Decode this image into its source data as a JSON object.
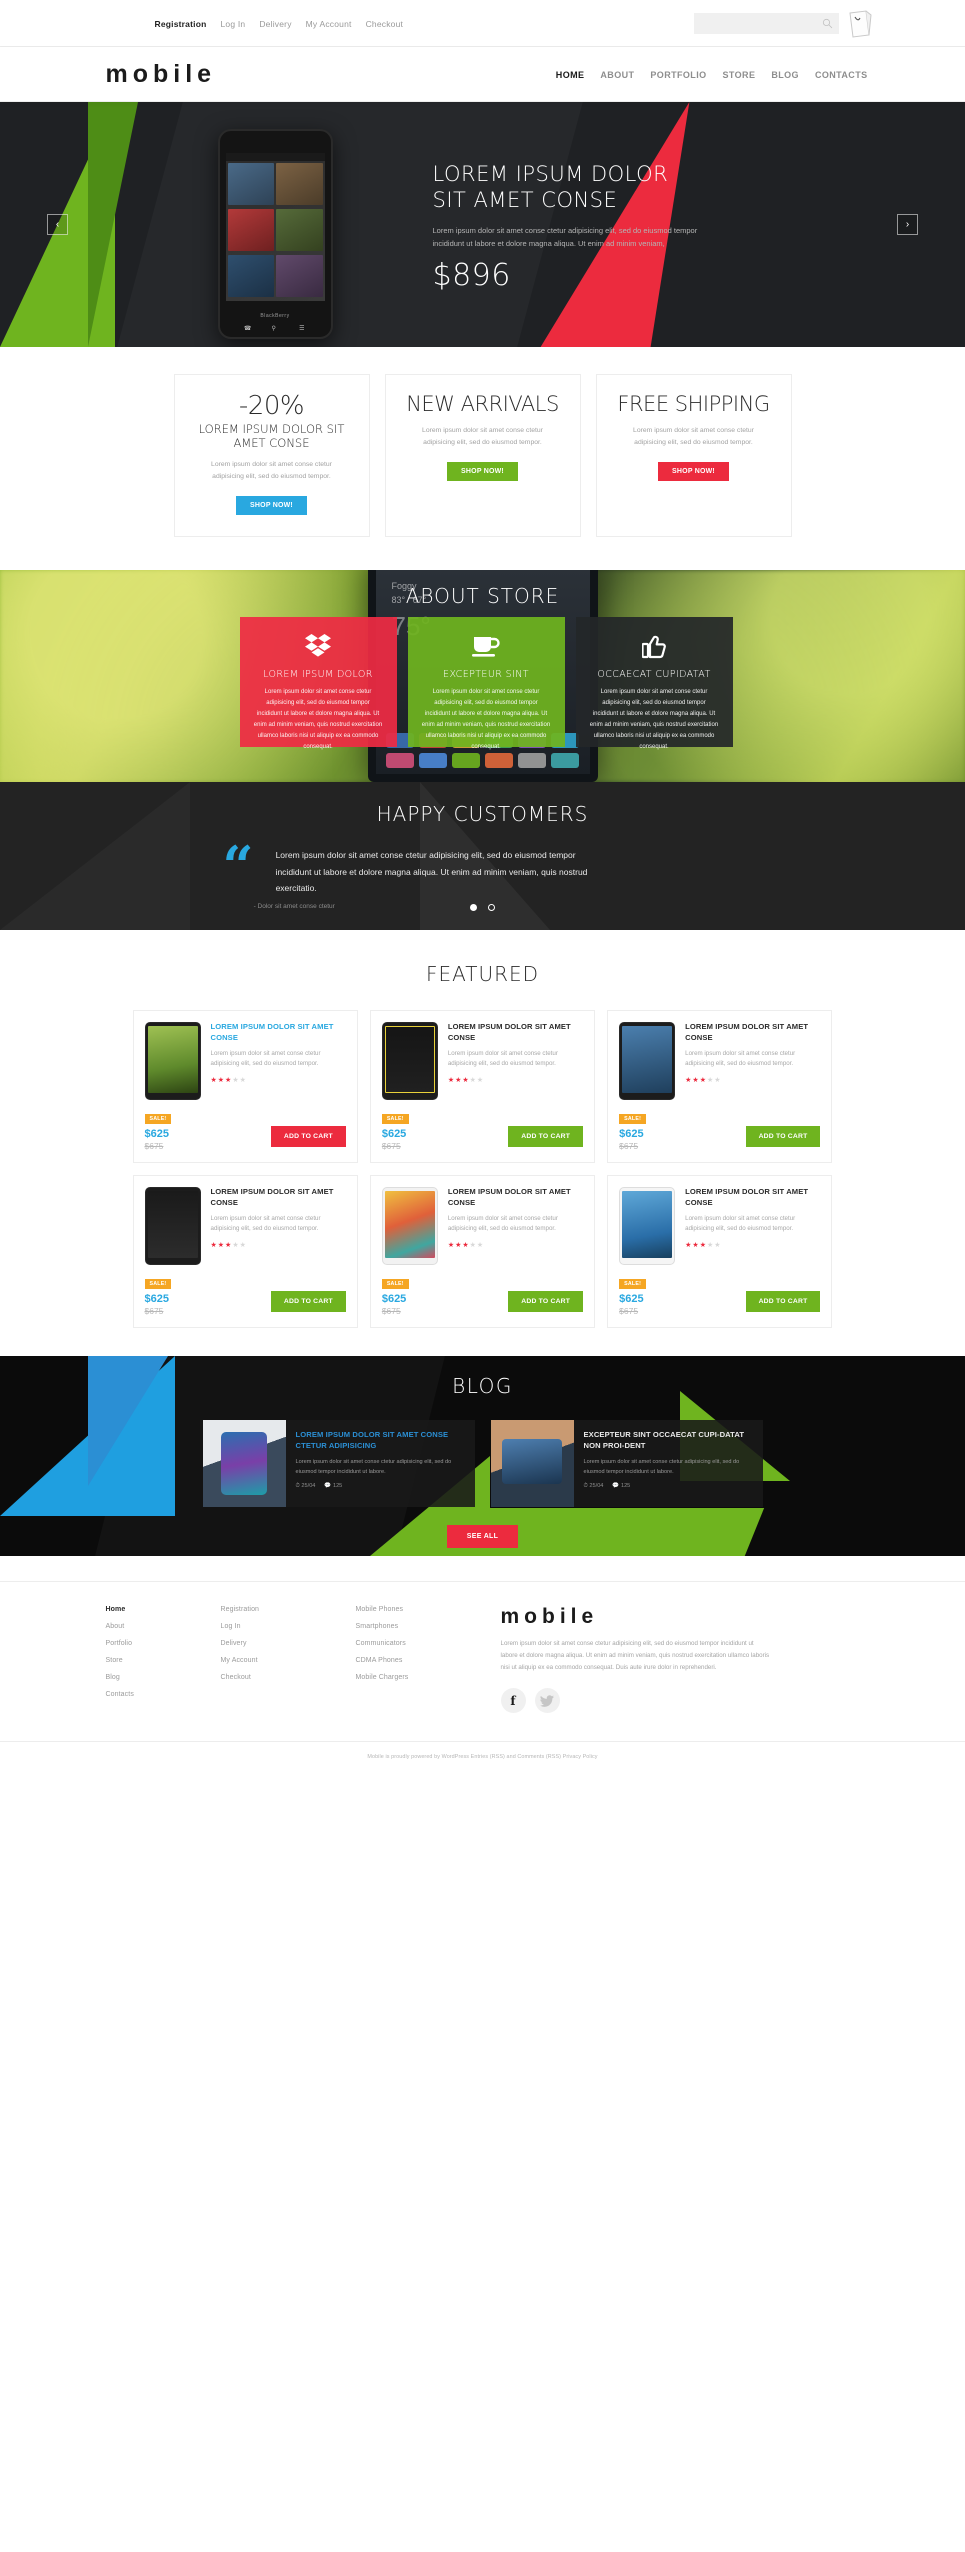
{
  "topbar": {
    "links": [
      {
        "label": "Registration",
        "active": true
      },
      {
        "label": "Log In",
        "active": false
      },
      {
        "label": "Delivery",
        "active": false
      },
      {
        "label": "My Account",
        "active": false
      },
      {
        "label": "Checkout",
        "active": false
      }
    ],
    "search": {
      "value": "",
      "placeholder": ""
    },
    "search_icon": "search-icon",
    "cart_icon": "cart-icon"
  },
  "header": {
    "logo": "mobile",
    "nav": [
      {
        "label": "HOME",
        "active": true
      },
      {
        "label": "ABOUT",
        "active": false
      },
      {
        "label": "PORTFOLIO",
        "active": false
      },
      {
        "label": "STORE",
        "active": false
      },
      {
        "label": "BLOG",
        "active": false
      },
      {
        "label": "CONTACTS",
        "active": false
      }
    ]
  },
  "hero": {
    "title_line1": "LOREM IPSUM DOLOR",
    "title_line2": "SIT AMET CONSE",
    "description": "Lorem ipsum dolor sit amet conse ctetur adipisicing elit, sed do eiusmod tempor incididunt ut labore et dolore magna aliqua. Ut enim ad minim veniam,",
    "price": "$896",
    "prev_label": "‹",
    "next_label": "›",
    "colors": {
      "blue": "#2b8fd4",
      "green": "#6fb41f",
      "red": "#ec2b3e",
      "dark": "#1f2124"
    }
  },
  "promos": [
    {
      "big": "-20%",
      "sub": "LOREM IPSUM DOLOR SIT AMET CONSE",
      "desc": "Lorem ipsum dolor sit amet conse ctetur adipisicing elit, sed do eiusmod tempor.",
      "button": "SHOP NOW!",
      "color": "#29a8e0"
    },
    {
      "big": "NEW ARRIVALS",
      "sub": "",
      "desc": "Lorem ipsum dolor sit amet conse ctetur adipisicing elit, sed do eiusmod tempor.",
      "button": "SHOP NOW!",
      "color": "#6fb41f"
    },
    {
      "big": "FREE SHIPPING",
      "sub": "",
      "desc": "Lorem ipsum dolor sit amet conse ctetur adipisicing elit, sed do eiusmod tempor.",
      "button": "SHOP NOW!",
      "color": "#ec2b3e"
    }
  ],
  "about": {
    "title": "ABOUT STORE",
    "weather": {
      "condition": "Foggy",
      "high": "83°",
      "low": "67°",
      "current": "75°"
    },
    "cards": [
      {
        "icon": "dropbox-icon",
        "title": "LOREM IPSUM DOLOR",
        "desc": "Lorem ipsum dolor sit amet conse ctetur adipisicing elit, sed do eiusmod tempor incididunt ut labore et dolore magna aliqua. Ut enim ad minim veniam, quis nostrud exercitation ullamco laboris nisi ut aliquip ex ea commodo consequat.",
        "color": "#ee2b44"
      },
      {
        "icon": "coffee-cup-icon",
        "title": "EXCEPTEUR SINT",
        "desc": "Lorem ipsum dolor sit amet conse ctetur adipisicing elit, sed do eiusmod tempor incididunt ut labore et dolore magna aliqua. Ut enim ad minim veniam, quis nostrud exercitation ullamco laboris nisi ut aliquip ex ea commodo consequat.",
        "color": "#6fb41f"
      },
      {
        "icon": "thumbs-up-icon",
        "title": "OCCAECAT CUPIDATAT",
        "desc": "Lorem ipsum dolor sit amet conse ctetur adipisicing elit, sed do eiusmod tempor incididunt ut labore et dolore magna aliqua. Ut enim ad minim veniam, quis nostrud exercitation ullamco laboris nisi ut aliquip ex ea commodo consequat.",
        "color": "#242729"
      }
    ]
  },
  "testimonial": {
    "title": "HAPPY CUSTOMERS",
    "quote": "Lorem ipsum dolor sit amet conse ctetur adipisicing elit, sed do eiusmod tempor incididunt ut labore et dolore magna aliqua. Ut enim ad minim veniam, quis nostrud exercitatio.",
    "author": "-  Dolor sit amet conse ctetur",
    "dots": [
      {
        "active": true
      },
      {
        "active": false
      }
    ]
  },
  "featured": {
    "title": "FEATURED",
    "products": [
      {
        "title": "LOREM IPSUM DOLOR SIT AMET CONSE",
        "desc": "Lorem ipsum dolor sit amet conse ctetur adipisicing elit, sed do eiusmod tempor.",
        "rating": 3,
        "rating_max": 5,
        "badge": "SALE!",
        "price": "$625",
        "old_price": "$675",
        "button": "ADD TO CART",
        "button_color": "#ec2b3e",
        "title_highlight": true
      },
      {
        "title": "LOREM IPSUM DOLOR SIT AMET CONSE",
        "desc": "Lorem ipsum dolor sit amet conse ctetur adipisicing elit, sed do eiusmod tempor.",
        "rating": 3,
        "rating_max": 5,
        "badge": "SALE!",
        "price": "$625",
        "old_price": "$675",
        "button": "ADD TO CART",
        "button_color": "#6fb41f",
        "title_highlight": false
      },
      {
        "title": "LOREM IPSUM DOLOR SIT AMET CONSE",
        "desc": "Lorem ipsum dolor sit amet conse ctetur adipisicing elit, sed do eiusmod tempor.",
        "rating": 3,
        "rating_max": 5,
        "badge": "SALE!",
        "price": "$625",
        "old_price": "$675",
        "button": "ADD TO CART",
        "button_color": "#6fb41f",
        "title_highlight": false
      },
      {
        "title": "LOREM IPSUM DOLOR SIT AMET CONSE",
        "desc": "Lorem ipsum dolor sit amet conse ctetur adipisicing elit, sed do eiusmod tempor.",
        "rating": 3,
        "rating_max": 5,
        "badge": "SALE!",
        "price": "$625",
        "old_price": "$675",
        "button": "ADD TO CART",
        "button_color": "#6fb41f",
        "title_highlight": false
      },
      {
        "title": "LOREM IPSUM DOLOR SIT AMET CONSE",
        "desc": "Lorem ipsum dolor sit amet conse ctetur adipisicing elit, sed do eiusmod tempor.",
        "rating": 3,
        "rating_max": 5,
        "badge": "SALE!",
        "price": "$625",
        "old_price": "$675",
        "button": "ADD TO CART",
        "button_color": "#6fb41f",
        "title_highlight": false
      },
      {
        "title": "LOREM IPSUM DOLOR SIT AMET CONSE",
        "desc": "Lorem ipsum dolor sit amet conse ctetur adipisicing elit, sed do eiusmod tempor.",
        "rating": 3,
        "rating_max": 5,
        "badge": "SALE!",
        "price": "$625",
        "old_price": "$675",
        "button": "ADD TO CART",
        "button_color": "#6fb41f",
        "title_highlight": false
      }
    ]
  },
  "blog": {
    "title": "BLOG",
    "posts": [
      {
        "title": "LOREM IPSUM DOLOR SIT AMET CONSE CTETUR ADIPISICING",
        "desc": "Lorem ipsum dolor sit amet conse ctetur adipisicing elit, sed do eiusmod tempor incididunt ut labore.",
        "date": "25/04",
        "comments": "125",
        "highlight": true
      },
      {
        "title": "EXCEPTEUR SINT OCCAECAT CUPI-DATAT NON PROI-DENT",
        "desc": "Lorem ipsum dolor sit amet conse ctetur adipisicing elit, sed do eiusmod tempor incididunt ut labore.",
        "date": "25/04",
        "comments": "125",
        "highlight": false
      }
    ],
    "see_all": "SEE ALL"
  },
  "footer": {
    "col1": [
      {
        "label": "Home",
        "active": true
      },
      {
        "label": "About",
        "active": false
      },
      {
        "label": "Portfolio",
        "active": false
      },
      {
        "label": "Store",
        "active": false
      },
      {
        "label": "Blog",
        "active": false
      },
      {
        "label": "Contacts",
        "active": false
      }
    ],
    "col2": [
      {
        "label": "Registration",
        "active": false
      },
      {
        "label": "Log In",
        "active": false
      },
      {
        "label": "Delivery",
        "active": false
      },
      {
        "label": "My Account",
        "active": false
      },
      {
        "label": "Checkout",
        "active": false
      }
    ],
    "col3": [
      {
        "label": "Mobile Phones",
        "active": false
      },
      {
        "label": "Smartphones",
        "active": false
      },
      {
        "label": "Communicators",
        "active": false
      },
      {
        "label": "CDMA Phones",
        "active": false
      },
      {
        "label": "Mobile Chargers",
        "active": false
      }
    ],
    "logo": "mobile",
    "about_text": "Lorem ipsum dolor sit amet conse ctetur adipisicing elit, sed do eiusmod tempor incididunt ut labore et dolore magna aliqua. Ut enim ad minim veniam, quis nostrud exercitation ullamco laboris nisi ut aliquip ex ea commodo consequat. Duis aute irure dolor in reprehenderi.",
    "socials": [
      {
        "name": "facebook-icon",
        "glyph": "f"
      },
      {
        "name": "twitter-icon",
        "glyph": ""
      }
    ],
    "copyright": "Mobile is proudly powered by WordPress Entries (RSS) and Comments (RSS) Privacy Policy"
  }
}
